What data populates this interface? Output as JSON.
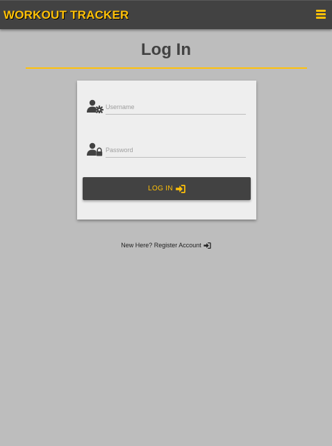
{
  "app": {
    "title": "WORKOUT TRACKER"
  },
  "colors": {
    "accent": "#ffc107",
    "navbar": "#424242",
    "background": "#bdbdbd",
    "card": "#eeeeee"
  },
  "icons": {
    "menu": "hamburger-icon",
    "username": "user-gear-icon",
    "password": "user-lock-icon",
    "login": "sign-in-icon",
    "register": "sign-in-icon"
  },
  "page": {
    "title": "Log In"
  },
  "form": {
    "username_placeholder": "Username",
    "username_value": "",
    "password_placeholder": "Password",
    "password_value": "",
    "login_label": "LOG IN"
  },
  "register": {
    "label": "New Here? Register Account"
  }
}
